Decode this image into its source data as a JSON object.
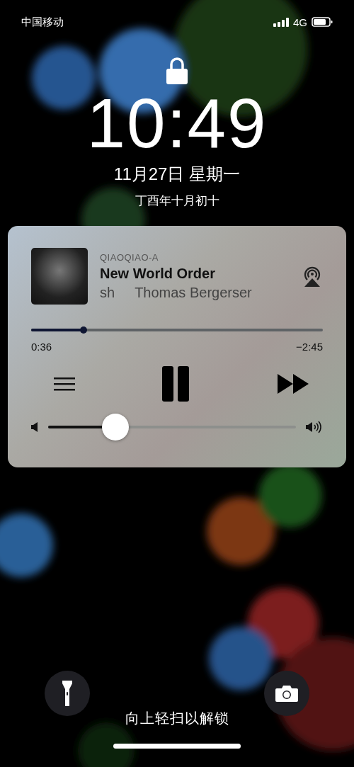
{
  "status_bar": {
    "carrier": "中国移动",
    "network": "4G"
  },
  "lock": {
    "locked": true
  },
  "clock": {
    "time": "10:49",
    "date": "11月27日 星期一",
    "lunar_date": "丁酉年十月初十"
  },
  "now_playing": {
    "source": "QIAOQIAO-A",
    "title": "New World Order",
    "subtitle_parts": [
      "sh",
      "Thomas Bergerser"
    ],
    "progress": {
      "level": 0.18,
      "elapsed": "0:36",
      "remaining": "−2:45"
    },
    "playing": true,
    "volume": {
      "level": 0.27
    }
  },
  "unlock_hint": "向上轻扫以解锁"
}
